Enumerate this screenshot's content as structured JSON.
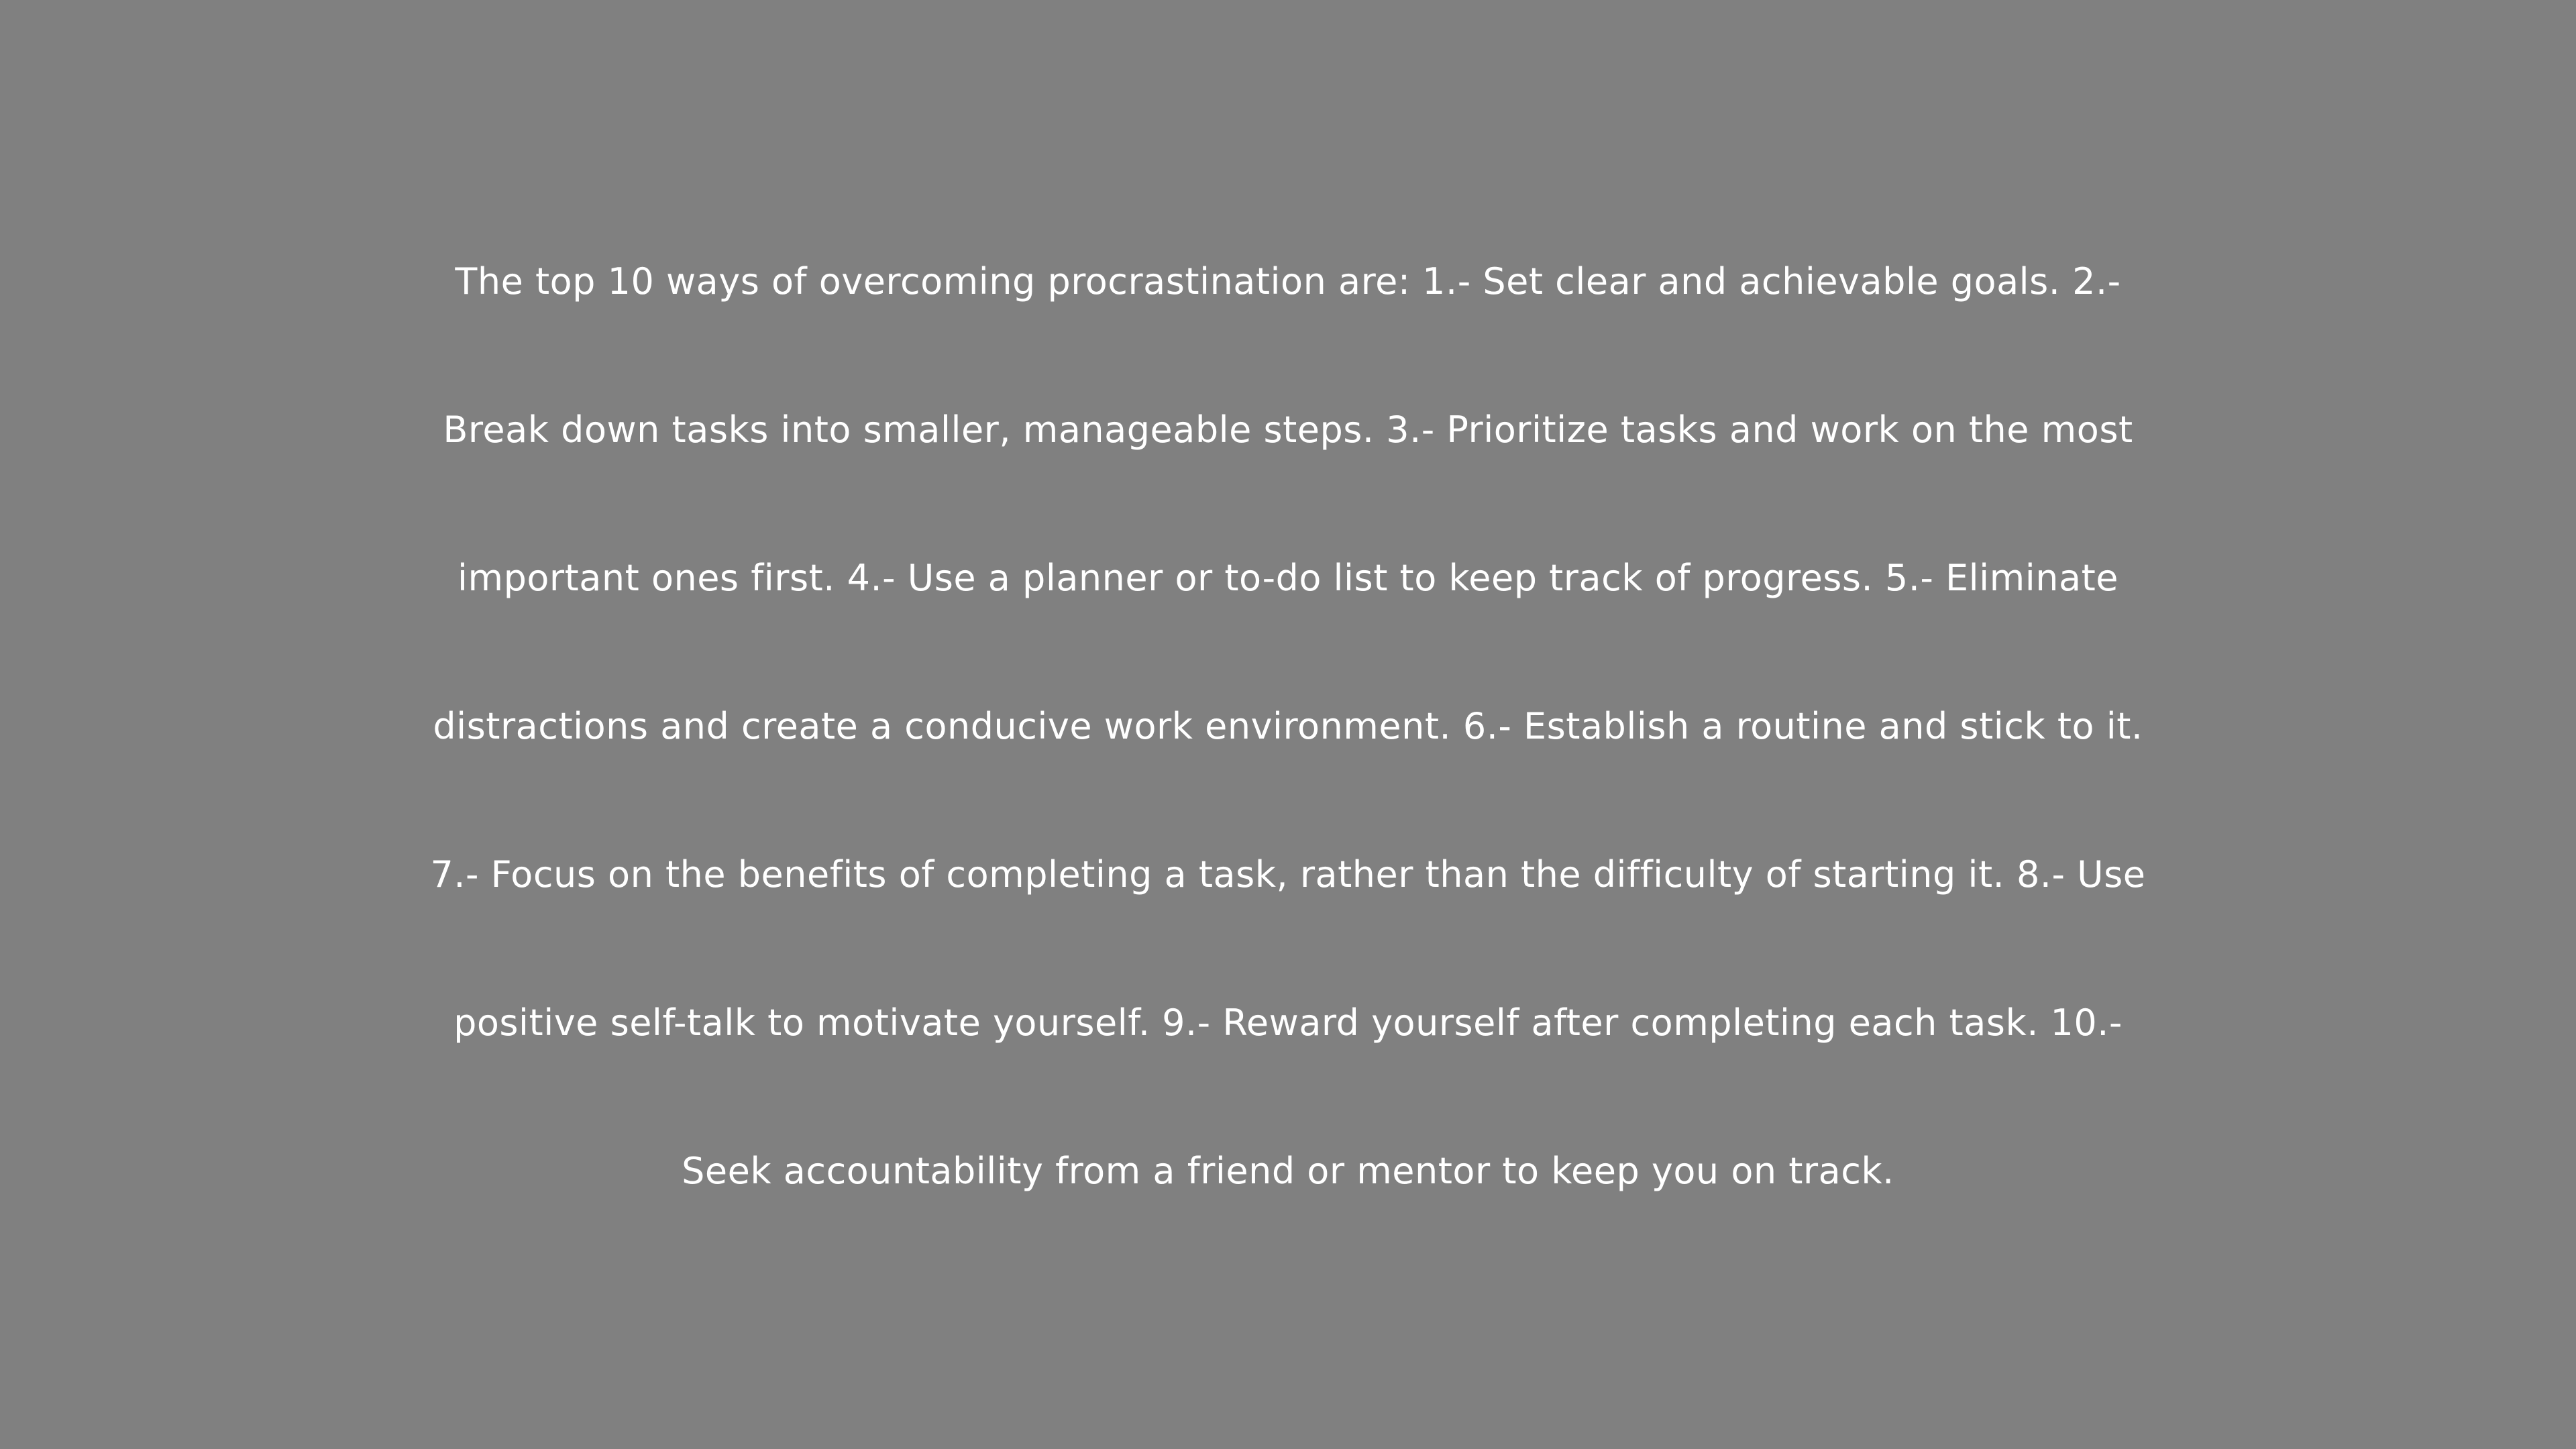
{
  "background_color": "#808080",
  "text_color": "#ffffff",
  "lines": [
    "The top 10 ways of overcoming procrastination are: 1.- Set clear and achievable goals. 2.-",
    "Break down tasks into smaller, manageable steps. 3.- Prioritize tasks and work on the most",
    "important ones first. 4.- Use a planner or to-do list to keep track of progress. 5.- Eliminate",
    "distractions and create a conducive work environment. 6.- Establish a routine and stick to it.",
    "7.- Focus on the benefits of completing a task, rather than the difficulty of starting it. 8.- Use",
    "positive self-talk to motivate yourself. 9.- Reward yourself after completing each task. 10.-",
    "Seek accountability from a friend or mentor to keep you on track."
  ]
}
